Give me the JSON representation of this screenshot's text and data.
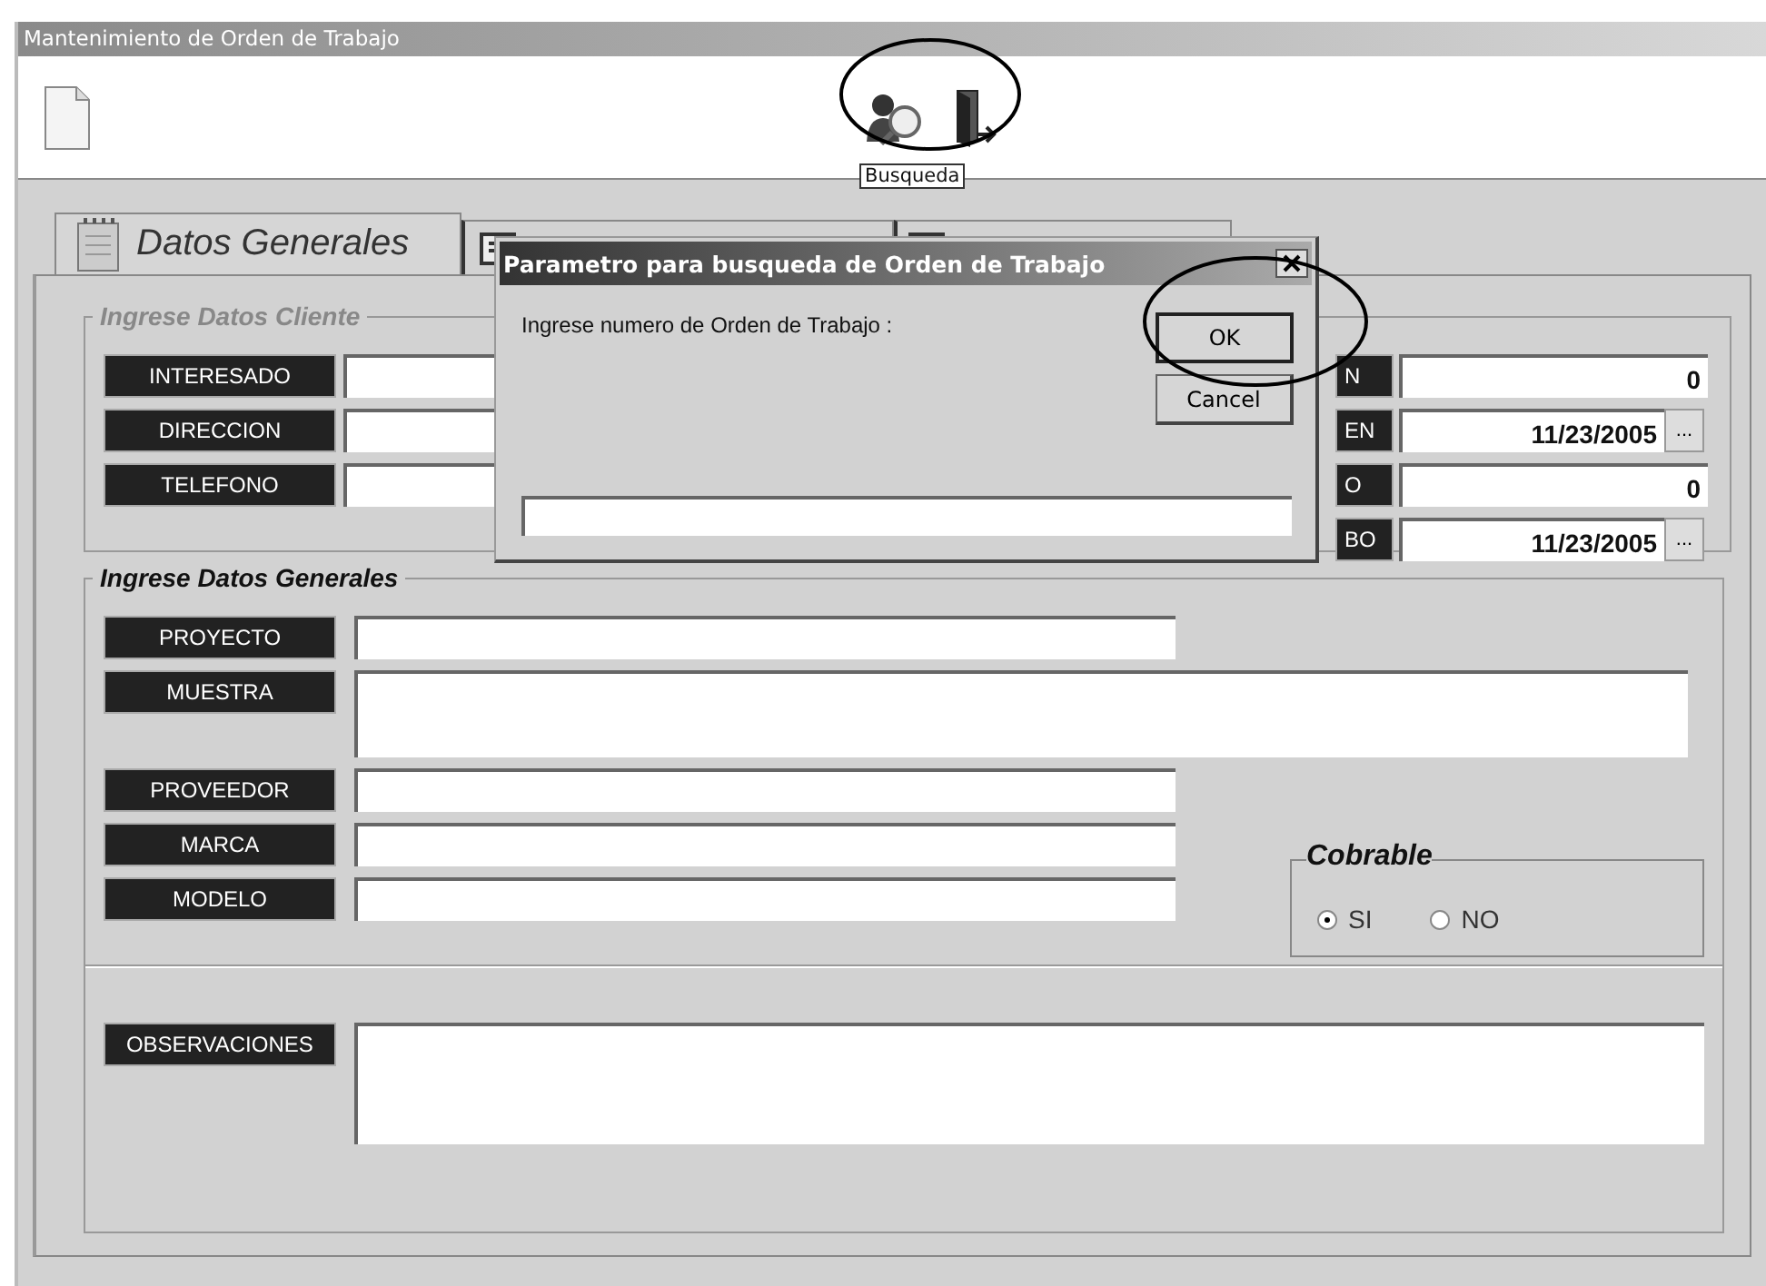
{
  "window": {
    "title": "Mantenimiento de Orden de Trabajo"
  },
  "toolbar": {
    "tooltip": "Busqueda"
  },
  "tabs": [
    {
      "label": "Datos Generales",
      "selected": true
    },
    {
      "selected": false
    },
    {
      "selected": false
    }
  ],
  "client_group": {
    "title": "Ingrese Datos Cliente",
    "fields": [
      {
        "label": "INTERESADO"
      },
      {
        "label": "DIRECCION"
      },
      {
        "label": "TELEFONO"
      }
    ],
    "right_fields": [
      {
        "label": "N",
        "value": "0",
        "kind": "number"
      },
      {
        "label": "EN",
        "value": "11/23/2005",
        "kind": "date",
        "button": "..."
      },
      {
        "label": "O",
        "value": "0",
        "kind": "number"
      },
      {
        "label": "BO",
        "value": "11/23/2005",
        "kind": "date",
        "button": "..."
      }
    ]
  },
  "general_group": {
    "title": "Ingrese Datos Generales",
    "fields": [
      {
        "label": "PROYECTO",
        "kind": "line"
      },
      {
        "label": "MUESTRA",
        "kind": "wide"
      },
      {
        "label": "PROVEEDOR",
        "kind": "line"
      },
      {
        "label": "MARCA",
        "kind": "line"
      },
      {
        "label": "MODELO",
        "kind": "line"
      }
    ],
    "cobrable": {
      "title": "Cobrable",
      "options": [
        {
          "label": "SI",
          "selected": true
        },
        {
          "label": "NO",
          "selected": false
        }
      ]
    },
    "observaciones": {
      "label": "OBSERVACIONES"
    }
  },
  "dialog": {
    "title": "Parametro para busqueda de Orden de Trabajo",
    "prompt": "Ingrese numero de Orden de Trabajo :",
    "buttons": [
      "OK",
      "Cancel"
    ]
  }
}
